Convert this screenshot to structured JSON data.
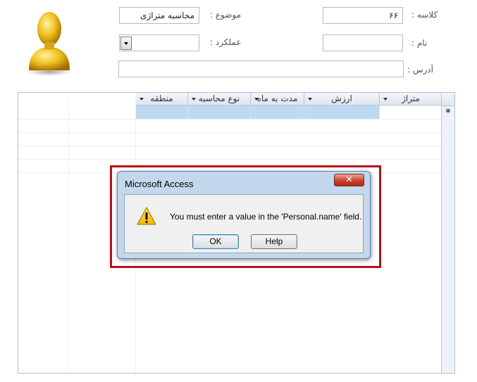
{
  "form": {
    "class_label": "کلاسه :",
    "class_value": "۶۶",
    "subject_label": "موضوع :",
    "subject_value": "محاسبه متراژی",
    "name_label": "نام :",
    "name_value": "",
    "performance_label": "عملکرد :",
    "performance_value": "",
    "address_label": "آدرس :",
    "address_value": ""
  },
  "grid": {
    "columns": [
      "متراژ",
      "ارزش",
      "مدت به ماه",
      "نوع محاسبه",
      "منطقه"
    ],
    "new_record_marker": "*"
  },
  "dialog": {
    "title": "Microsoft Access",
    "close_glyph": "✕",
    "message": "You must enter a value in the 'Personal.name' field.",
    "ok_label": "OK",
    "help_label": "Help"
  },
  "colors": {
    "highlight_border": "#b5121b",
    "new_row": "#bed9f3",
    "dialog_frame": "#c3d8ec"
  },
  "icons": {
    "avatar": "user-silhouette-icon",
    "warning": "warning-icon",
    "combo_arrow": "chevron-down-icon"
  }
}
